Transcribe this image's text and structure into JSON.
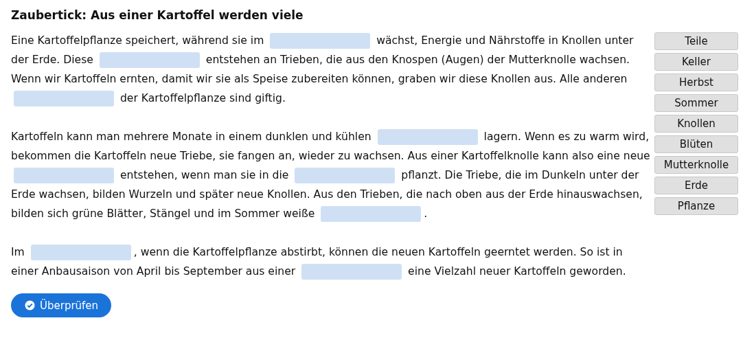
{
  "title": "Zaubertick: Aus einer Kartoffel werden viele",
  "paragraphs": [
    [
      {
        "kind": "text",
        "text": "Eine Kartoffelpflanze speichert, während sie im "
      },
      {
        "kind": "gap"
      },
      {
        "kind": "text",
        "text": " wächst, Energie und Nährstoffe in Knollen unter der Erde. Diese "
      },
      {
        "kind": "gap"
      },
      {
        "kind": "text",
        "text": " entstehen an Trieben, die aus den Knospen (Augen) der Mutterknolle wachsen. Wenn wir Kartoffeln ernten, damit wir sie als Speise zubereiten können, graben wir diese Knollen aus. Alle anderen "
      },
      {
        "kind": "gap"
      },
      {
        "kind": "text",
        "text": " der Kartoffelpflanze sind giftig."
      }
    ],
    [
      {
        "kind": "text",
        "text": "Kartoffeln kann man mehrere Monate in einem dunklen und kühlen "
      },
      {
        "kind": "gap"
      },
      {
        "kind": "text",
        "text": " lagern. Wenn es zu warm wird, bekommen die Kartoffeln neue Triebe, sie fangen an, wieder zu wachsen. Aus einer Kartoffelknolle kann also eine neue "
      },
      {
        "kind": "gap"
      },
      {
        "kind": "text",
        "text": " entstehen, wenn man sie in die "
      },
      {
        "kind": "gap"
      },
      {
        "kind": "text",
        "text": " pflanzt. Die Triebe, die im Dunkeln unter der Erde wachsen, bilden Wurzeln und später neue Knollen. Aus den Trieben, die nach oben aus der Erde hinauswachsen, bilden sich grüne Blätter, Stängel und im Sommer weiße "
      },
      {
        "kind": "gap"
      },
      {
        "kind": "text",
        "text": "."
      }
    ],
    [
      {
        "kind": "text",
        "text": "Im "
      },
      {
        "kind": "gap"
      },
      {
        "kind": "text",
        "text": ", wenn die Kartoffelpflanze abstirbt, können die neuen Kartoffeln geerntet werden. So ist in einer Anbausaison von April bis September aus einer "
      },
      {
        "kind": "gap"
      },
      {
        "kind": "text",
        "text": " eine Vielzahl neuer Kartoffeln geworden."
      }
    ]
  ],
  "check_button": "Überprüfen",
  "word_bank": [
    "Teile",
    "Keller",
    "Herbst",
    "Sommer",
    "Knollen",
    "Blüten",
    "Mutterknolle",
    "Erde",
    "Pflanze"
  ]
}
